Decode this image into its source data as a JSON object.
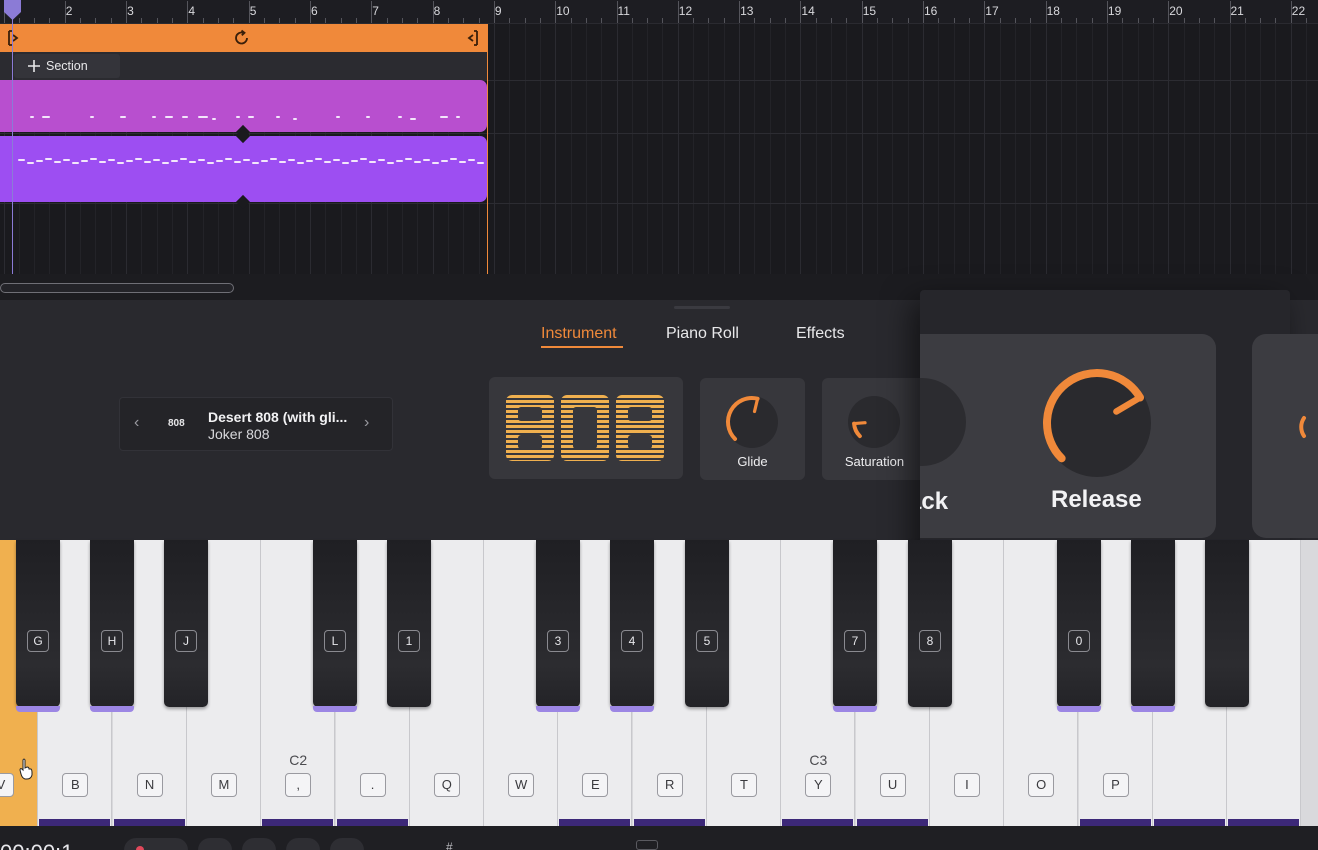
{
  "ruler": {
    "bars": [
      "2",
      "3",
      "4",
      "5",
      "6",
      "7",
      "8",
      "9",
      "10",
      "11",
      "12",
      "13",
      "14",
      "15",
      "16",
      "17",
      "18",
      "19",
      "20",
      "21",
      "22"
    ]
  },
  "timeline": {
    "section_button": "Section"
  },
  "tabs": {
    "instrument": "Instrument",
    "piano_roll": "Piano Roll",
    "effects": "Effects"
  },
  "preset": {
    "badge": "808",
    "name": "Desert 808 (with gli...",
    "pack": "Joker 808"
  },
  "instrument_logo": "808",
  "knobs": {
    "glide": {
      "label": "Glide",
      "value": 0.55
    },
    "saturation": {
      "label": "Saturation",
      "value": 0.15
    },
    "attack": {
      "label": "ack"
    },
    "release": {
      "label": "Release",
      "value": 0.72
    }
  },
  "keyboard": {
    "octave_labels": [
      "C2",
      "C3"
    ],
    "white_keys": [
      "V",
      "B",
      "N",
      "M",
      ",",
      ".",
      "Q",
      "W",
      "E",
      "R",
      "T",
      "Y",
      "U",
      "I",
      "O",
      "P",
      "",
      ""
    ],
    "black_keys": [
      "G",
      "H",
      "J",
      "L",
      "1",
      "3",
      "4",
      "5",
      "7",
      "8",
      "0",
      "",
      ""
    ]
  },
  "transport": {
    "time": "00:00:1"
  },
  "colors": {
    "accent": "#f0893a",
    "clip_pink": "#b84fcf",
    "clip_purple": "#9d4ef2",
    "key_pressed": "#f0b04f",
    "key_indicator": "#9c86e4"
  }
}
